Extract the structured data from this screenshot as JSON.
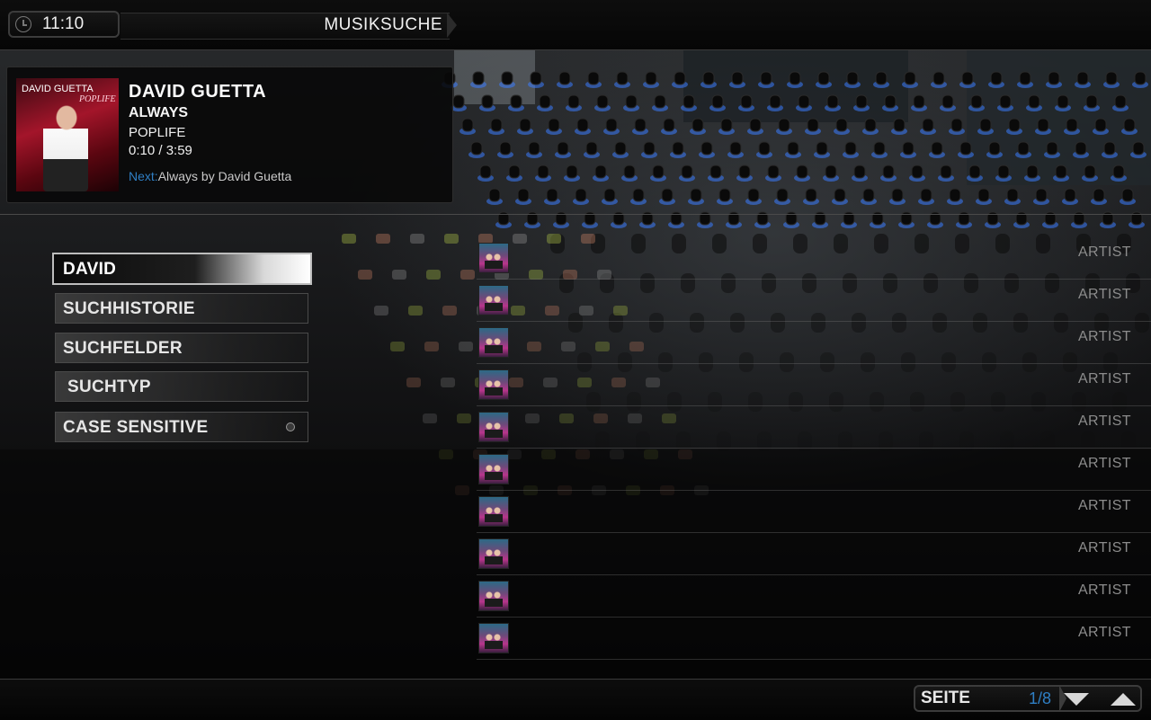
{
  "header": {
    "clock": "11:10",
    "title": "MUSIKSUCHE"
  },
  "now_playing": {
    "artist": "DAVID GUETTA",
    "track": "ALWAYS",
    "album": "POPLIFE",
    "time": "0:10 / 3:59",
    "next_label": "Next:",
    "next_text": "Always by David Guetta",
    "cover_artist": "DAVID GUETTA",
    "cover_album": "POPLIFE"
  },
  "menu": {
    "search_value": "DAVID",
    "items": [
      {
        "label": "SUCHHISTORIE"
      },
      {
        "label": "SUCHFELDER"
      },
      {
        "label": "SUCHTYP"
      },
      {
        "label": "CASE SENSITIVE"
      }
    ]
  },
  "results": [
    {
      "type": "ARTIST"
    },
    {
      "type": "ARTIST"
    },
    {
      "type": "ARTIST"
    },
    {
      "type": "ARTIST"
    },
    {
      "type": "ARTIST"
    },
    {
      "type": "ARTIST"
    },
    {
      "type": "ARTIST"
    },
    {
      "type": "ARTIST"
    },
    {
      "type": "ARTIST"
    },
    {
      "type": "ARTIST"
    }
  ],
  "pager": {
    "label": "SEITE",
    "page": "1/8"
  },
  "colors": {
    "accent_blue": "#2f7fc4",
    "text_dim": "#8c8c8c",
    "knob_glow": "#3a7bff"
  }
}
